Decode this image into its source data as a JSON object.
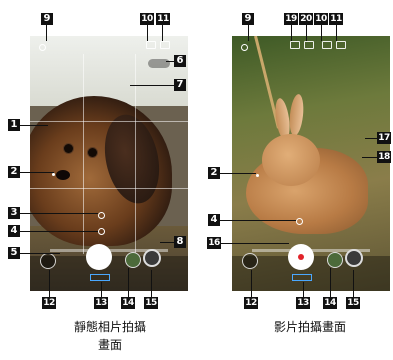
{
  "captions": {
    "photo_line1": "靜態相片拍攝",
    "photo_line2": "畫面",
    "video": "影片拍攝畫面"
  },
  "callouts": {
    "photo": {
      "c9": "9",
      "c10": "10",
      "c11": "11",
      "c6": "6",
      "c7": "7",
      "c1": "1",
      "c2": "2",
      "c3": "3",
      "c4": "4",
      "c5": "5",
      "c8": "8",
      "c12": "12",
      "c13": "13",
      "c14": "14",
      "c15": "15"
    },
    "video": {
      "c9": "9",
      "c19": "19",
      "c20": "20",
      "c10": "10",
      "c11": "11",
      "c17": "17",
      "c18": "18",
      "c2": "2",
      "c4": "4",
      "c16": "16",
      "c12": "12",
      "c13": "13",
      "c14": "14",
      "c15": "15"
    }
  },
  "colors": {
    "callout_bg": "#111111",
    "callout_text": "#ffffff",
    "record_red": "#e1232a",
    "mode_highlight": "#4aa8ff"
  },
  "icons": {
    "photo_shutter": "white-shutter-circle",
    "video_record": "white-circle-with-red-dot",
    "thumbnail": "last-shot-thumbnail",
    "switch_camera": "camera-switch-icon"
  }
}
